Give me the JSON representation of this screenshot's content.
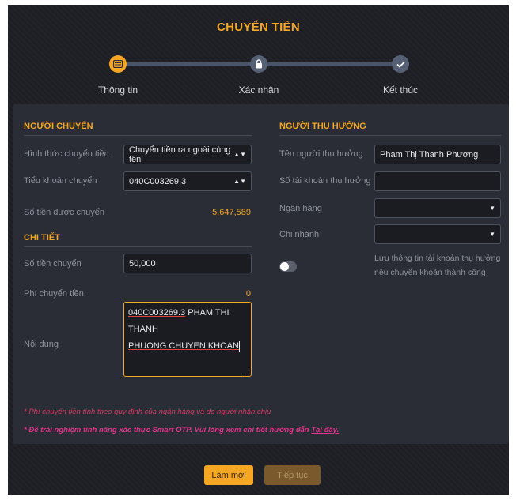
{
  "title": "CHUYỂN TIỀN",
  "steps": [
    {
      "label": "Thông tin",
      "icon": "card-icon",
      "active": true
    },
    {
      "label": "Xác nhận",
      "icon": "lock-icon",
      "active": false
    },
    {
      "label": "Kết thúc",
      "icon": "check-icon",
      "active": false
    }
  ],
  "sender": {
    "heading": "NGƯỜI CHUYỂN",
    "transfer_type_label": "Hình thức chuyển tiền",
    "transfer_type_value": "Chuyển tiền ra ngoài cùng tên",
    "sub_account_label": "Tiểu khoản chuyển",
    "sub_account_value": "040C003269.3",
    "available_label": "Số tiền được chuyển",
    "available_value": "5,647,589"
  },
  "detail": {
    "heading": "CHI TIẾT",
    "amount_label": "Số tiền chuyển",
    "amount_value": "50,000",
    "fee_label": "Phí chuyển tiền",
    "fee_value": "0",
    "content_label": "Nội dung",
    "content_line1_ul": "040C003269.3",
    "content_line1_rest": " PHAM THI THANH",
    "content_line2": "PHUONG CHUYEN KHOAN"
  },
  "beneficiary": {
    "heading": "NGƯỜI THỤ HƯỞNG",
    "name_label": "Tên người thụ hưởng",
    "name_value": "Phạm Thị Thanh Phượng",
    "account_label": "Số tài khoản thụ hưởng",
    "account_value": "",
    "bank_label": "Ngân hàng",
    "bank_value": "",
    "branch_label": "Chi nhánh",
    "branch_value": "",
    "save_text_1": "Lưu thông tin tài khoản thụ hưởng",
    "save_text_2": "nếu chuyển khoản thành công"
  },
  "notes": {
    "fee_note": "* Phí chuyển tiền tính theo quy định của ngân hàng và do người nhận chịu",
    "otp_note": "* Để trải nghiệm tính năng xác thực Smart OTP. Vui lòng xem chi tiết hướng dẫn ",
    "otp_link": "Tại đây."
  },
  "buttons": {
    "reset": "Làm mới",
    "next": "Tiếp tục"
  },
  "colors": {
    "accent": "#f5a623",
    "background": "#1d1f25",
    "panel": "#2a2d35",
    "note_pink": "#e0358c"
  }
}
